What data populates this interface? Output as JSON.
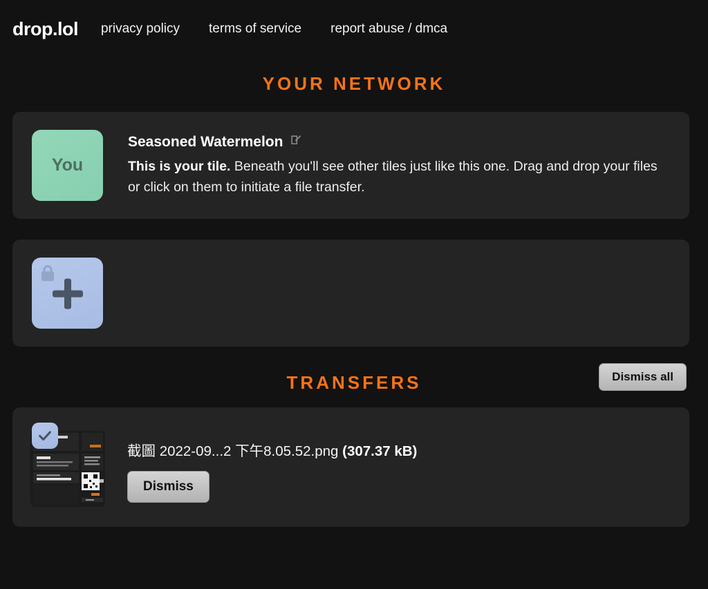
{
  "header": {
    "brand": "drop.lol",
    "nav": [
      {
        "label": "privacy policy"
      },
      {
        "label": "terms of service"
      },
      {
        "label": "report abuse / dmca"
      }
    ]
  },
  "network": {
    "title": "YOUR NETWORK",
    "self": {
      "tile_label": "You",
      "name": "Seasoned Watermelon",
      "edit_icon": "edit-square-icon",
      "desc_bold": "This is your tile.",
      "desc_rest": " Beneath you'll see other tiles just like this one. Drag and drop your files or click on them to initiate a file transfer."
    },
    "add_tile": {
      "lock_icon": "lock-icon",
      "plus_icon": "plus-icon"
    }
  },
  "transfers": {
    "title": "TRANSFERS",
    "dismiss_all_label": "Dismiss all",
    "items": [
      {
        "check_icon": "checkmark-icon",
        "filename": "截圖 2022-09...2 下午8.05.52.png",
        "size": "(307.37 kB)",
        "dismiss_label": "Dismiss"
      }
    ]
  },
  "colors": {
    "page_bg": "#121212",
    "panel_bg": "#242424",
    "accent_orange": "#f97316",
    "self_tile": "#8fd4b6",
    "add_tile": "#b0c2e8",
    "button": "#c6c6c6"
  }
}
